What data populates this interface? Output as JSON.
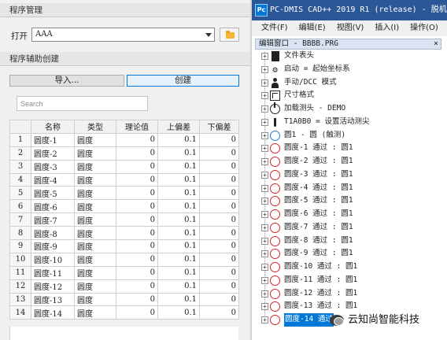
{
  "program_mgmt": {
    "title": "程序管理",
    "open_label": "打开",
    "open_value": "AAA"
  },
  "assist": {
    "title": "程序辅助创建",
    "import_label": "导入...",
    "create_label": "创建",
    "search_placeholder": "Search"
  },
  "table": {
    "columns": [
      "名称",
      "类型",
      "理论值",
      "上偏差",
      "下偏差"
    ],
    "rows": [
      {
        "n": "1",
        "name": "圆度-1",
        "type": "圆度",
        "nominal": "0",
        "upper": "0.1",
        "lower": "0"
      },
      {
        "n": "2",
        "name": "圆度-2",
        "type": "圆度",
        "nominal": "0",
        "upper": "0.1",
        "lower": "0"
      },
      {
        "n": "3",
        "name": "圆度-3",
        "type": "圆度",
        "nominal": "0",
        "upper": "0.1",
        "lower": "0"
      },
      {
        "n": "4",
        "name": "圆度-4",
        "type": "圆度",
        "nominal": "0",
        "upper": "0.1",
        "lower": "0"
      },
      {
        "n": "5",
        "name": "圆度-5",
        "type": "圆度",
        "nominal": "0",
        "upper": "0.1",
        "lower": "0"
      },
      {
        "n": "6",
        "name": "圆度-6",
        "type": "圆度",
        "nominal": "0",
        "upper": "0.1",
        "lower": "0"
      },
      {
        "n": "7",
        "name": "圆度-7",
        "type": "圆度",
        "nominal": "0",
        "upper": "0.1",
        "lower": "0"
      },
      {
        "n": "8",
        "name": "圆度-8",
        "type": "圆度",
        "nominal": "0",
        "upper": "0.1",
        "lower": "0"
      },
      {
        "n": "9",
        "name": "圆度-9",
        "type": "圆度",
        "nominal": "0",
        "upper": "0.1",
        "lower": "0"
      },
      {
        "n": "10",
        "name": "圆度-10",
        "type": "圆度",
        "nominal": "0",
        "upper": "0.1",
        "lower": "0"
      },
      {
        "n": "11",
        "name": "圆度-11",
        "type": "圆度",
        "nominal": "0",
        "upper": "0.1",
        "lower": "0"
      },
      {
        "n": "12",
        "name": "圆度-12",
        "type": "圆度",
        "nominal": "0",
        "upper": "0.1",
        "lower": "0"
      },
      {
        "n": "13",
        "name": "圆度-13",
        "type": "圆度",
        "nominal": "0",
        "upper": "0.1",
        "lower": "0"
      },
      {
        "n": "14",
        "name": "圆度-14",
        "type": "圆度",
        "nominal": "0",
        "upper": "0.1",
        "lower": "0"
      }
    ]
  },
  "window": {
    "app_icon": "Pc",
    "title": "PC-DMIS CAD++ 2019 R1 (release) - 脱机 (管"
  },
  "menu": [
    "文件(F)",
    "编辑(E)",
    "视图(V)",
    "插入(I)",
    "操作(O)",
    "窗口"
  ],
  "edit_window": {
    "title": "编辑窗口 - BBBB.PRG",
    "close": "×"
  },
  "tree": [
    {
      "icon": "file-header-icon",
      "text": "文件表头",
      "selected": false
    },
    {
      "icon": "startup-icon",
      "text": "启动 = 起始坐标系",
      "selected": false
    },
    {
      "icon": "manual-dcc-icon",
      "text": "手动/DCC 模式",
      "selected": false
    },
    {
      "icon": "dimension-format-icon",
      "text": "尺寸格式",
      "selected": false
    },
    {
      "icon": "load-probe-icon",
      "text": "加载测头 - DEMO",
      "selected": false
    },
    {
      "icon": "probe-tip-icon",
      "text": "T1A0B0 = 设置活动测尖",
      "selected": false
    },
    {
      "icon": "circle-measured-icon",
      "text": "圆1 - 圆 (触测)",
      "selected": false
    },
    {
      "icon": "roundness-icon",
      "text": "圆度-1  通过 : 圆1",
      "selected": false
    },
    {
      "icon": "roundness-icon",
      "text": "圆度-2  通过 : 圆1",
      "selected": false
    },
    {
      "icon": "roundness-icon",
      "text": "圆度-3  通过 : 圆1",
      "selected": false
    },
    {
      "icon": "roundness-icon",
      "text": "圆度-4  通过 : 圆1",
      "selected": false
    },
    {
      "icon": "roundness-icon",
      "text": "圆度-5  通过 : 圆1",
      "selected": false
    },
    {
      "icon": "roundness-icon",
      "text": "圆度-6  通过 : 圆1",
      "selected": false
    },
    {
      "icon": "roundness-icon",
      "text": "圆度-7  通过 : 圆1",
      "selected": false
    },
    {
      "icon": "roundness-icon",
      "text": "圆度-8  通过 : 圆1",
      "selected": false
    },
    {
      "icon": "roundness-icon",
      "text": "圆度-9  通过 : 圆1",
      "selected": false
    },
    {
      "icon": "roundness-icon",
      "text": "圆度-10  通过 : 圆1",
      "selected": false
    },
    {
      "icon": "roundness-icon",
      "text": "圆度-11  通过 : 圆1",
      "selected": false
    },
    {
      "icon": "roundness-icon",
      "text": "圆度-12  通过 : 圆1",
      "selected": false
    },
    {
      "icon": "roundness-icon",
      "text": "圆度-13  通过 : 圆1",
      "selected": false
    },
    {
      "icon": "roundness-icon",
      "text": "圆度-14  通过",
      "selected": true
    }
  ],
  "watermark": "云知尚智能科技",
  "colors": {
    "titlebar": "#2b5797",
    "selection": "#0078d7",
    "roundness_icon": "#d8232a",
    "measured_circle_icon": "#1c7ed6"
  }
}
